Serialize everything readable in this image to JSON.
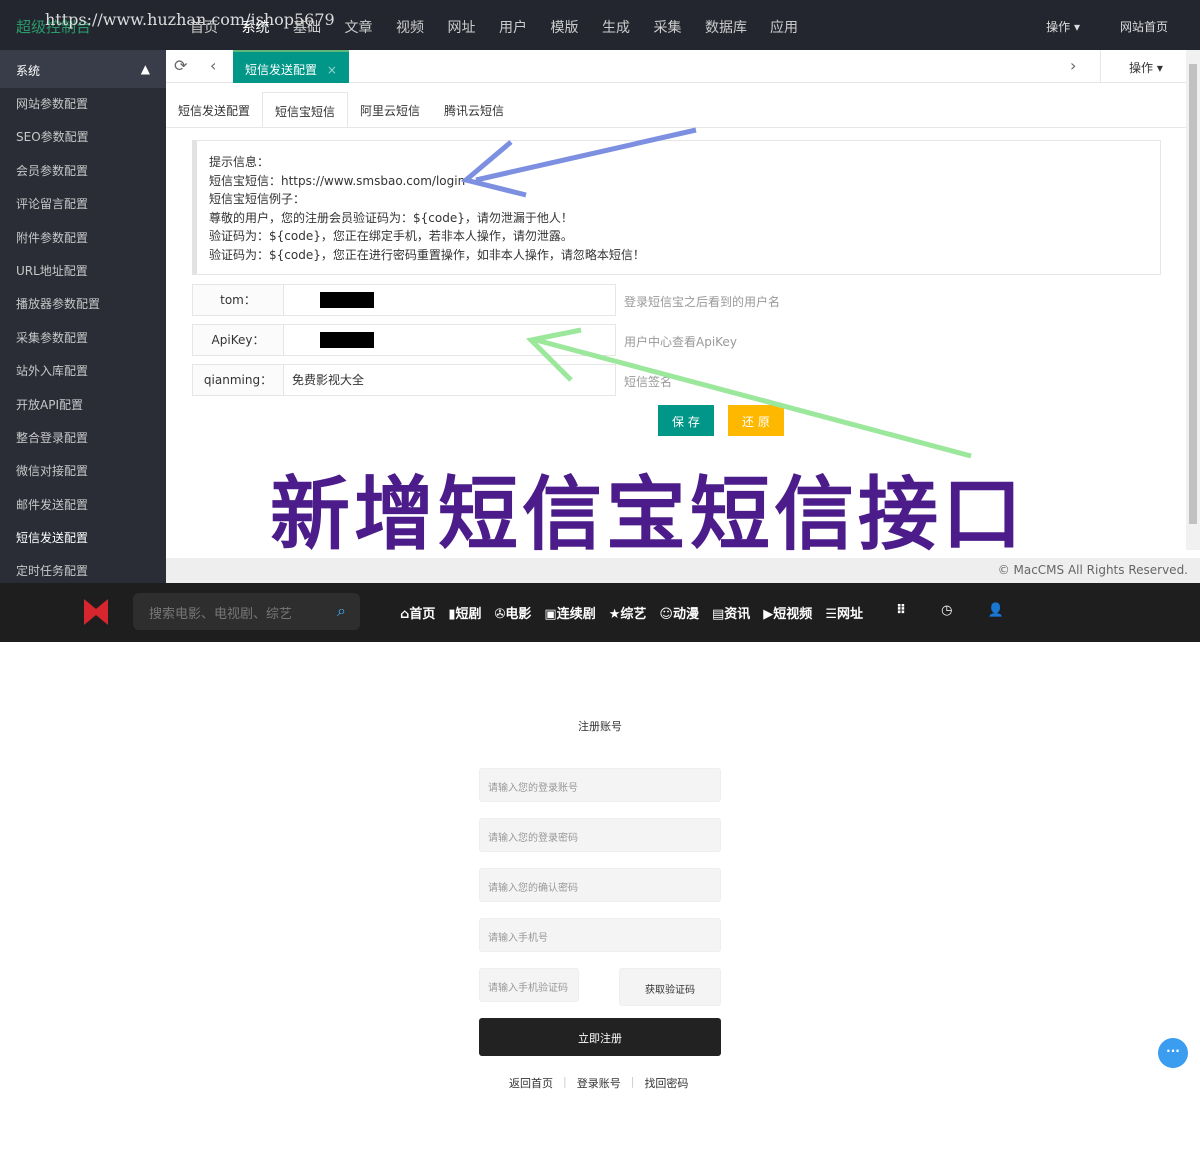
{
  "top": {
    "logo": "超级控制台",
    "watermark": "https://www.huzhan.com/ishop5679",
    "nav": [
      "首页",
      "系统",
      "基础",
      "文章",
      "视频",
      "网址",
      "用户",
      "模版",
      "生成",
      "采集",
      "数据库",
      "应用"
    ],
    "ops": "操作",
    "home": "网站首页"
  },
  "sidebar": {
    "head": "系统",
    "items": [
      "网站参数配置",
      "SEO参数配置",
      "会员参数配置",
      "评论留言配置",
      "附件参数配置",
      "URL地址配置",
      "播放器参数配置",
      "采集参数配置",
      "站外入库配置",
      "开放API配置",
      "整合登录配置",
      "微信对接配置",
      "邮件发送配置",
      "短信发送配置",
      "定时任务配置"
    ]
  },
  "tabbar": {
    "active": "短信发送配置",
    "close": "×",
    "ops": "操作"
  },
  "subtabs": [
    "短信发送配置",
    "短信宝短信",
    "阿里云短信",
    "腾讯云短信"
  ],
  "tips": [
    "提示信息：",
    "短信宝短信：https://www.smsbao.com/login",
    "短信宝短信例子：",
    "尊敬的用户，您的注册会员验证码为：${code}，请勿泄漏于他人！",
    "验证码为：${code}，您正在绑定手机，若非本人操作，请勿泄露。",
    "验证码为：${code}，您正在进行密码重置操作，如非本人操作，请忽略本短信！"
  ],
  "fields": [
    {
      "label": "tom：",
      "value": "",
      "hint": "登录短信宝之后看到的用户名"
    },
    {
      "label": "ApiKey：",
      "value": "",
      "hint": "用户中心查看ApiKey"
    },
    {
      "label": "qianming：",
      "value": "免费影视大全",
      "hint": "短信签名"
    }
  ],
  "buttons": {
    "save": "保 存",
    "reset": "还 原"
  },
  "banner": "新增短信宝短信接口",
  "footer": "© MacCMS All Rights Reserved.",
  "front": {
    "search_placeholder": "搜索电影、电视剧、综艺",
    "nav": [
      "首页",
      "短剧",
      "电影",
      "连续剧",
      "综艺",
      "动漫",
      "资讯",
      "短视频",
      "网址"
    ]
  },
  "register": {
    "title": "注册账号",
    "fields": [
      "请输入您的登录账号",
      "请输入您的登录密码",
      "请输入您的确认密码",
      "请输入手机号",
      "请输入手机验证码"
    ],
    "get_code": "获取验证码",
    "submit": "立即注册",
    "links": [
      "返回首页",
      "登录账号",
      "找回密码"
    ]
  }
}
